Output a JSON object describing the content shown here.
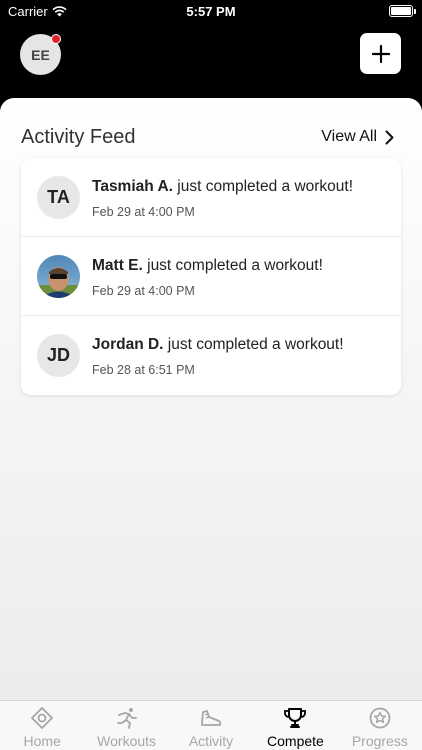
{
  "status_bar": {
    "carrier": "Carrier",
    "time": "5:57 PM"
  },
  "header": {
    "user_initials": "EE"
  },
  "feed": {
    "title": "Activity Feed",
    "view_all": "View All",
    "items": [
      {
        "initials": "TA",
        "name": "Tasmiah A.",
        "action": " just completed a workout!",
        "time": "Feb 29 at 4:00 PM",
        "has_photo": false
      },
      {
        "initials": "",
        "name": "Matt E.",
        "action": " just completed a workout!",
        "time": "Feb 29 at 4:00 PM",
        "has_photo": true
      },
      {
        "initials": "JD",
        "name": "Jordan D.",
        "action": " just completed a workout!",
        "time": "Feb 28 at 6:51 PM",
        "has_photo": false
      }
    ]
  },
  "tabs": [
    {
      "label": "Home",
      "icon": "home-target-icon",
      "active": false
    },
    {
      "label": "Workouts",
      "icon": "runner-icon",
      "active": false
    },
    {
      "label": "Activity",
      "icon": "shoe-icon",
      "active": false
    },
    {
      "label": "Compete",
      "icon": "trophy-icon",
      "active": true
    },
    {
      "label": "Progress",
      "icon": "star-badge-icon",
      "active": false
    }
  ],
  "colors": {
    "notification": "#e0222a",
    "active_tab": "#000000",
    "inactive_tab": "#a6a6a6"
  }
}
